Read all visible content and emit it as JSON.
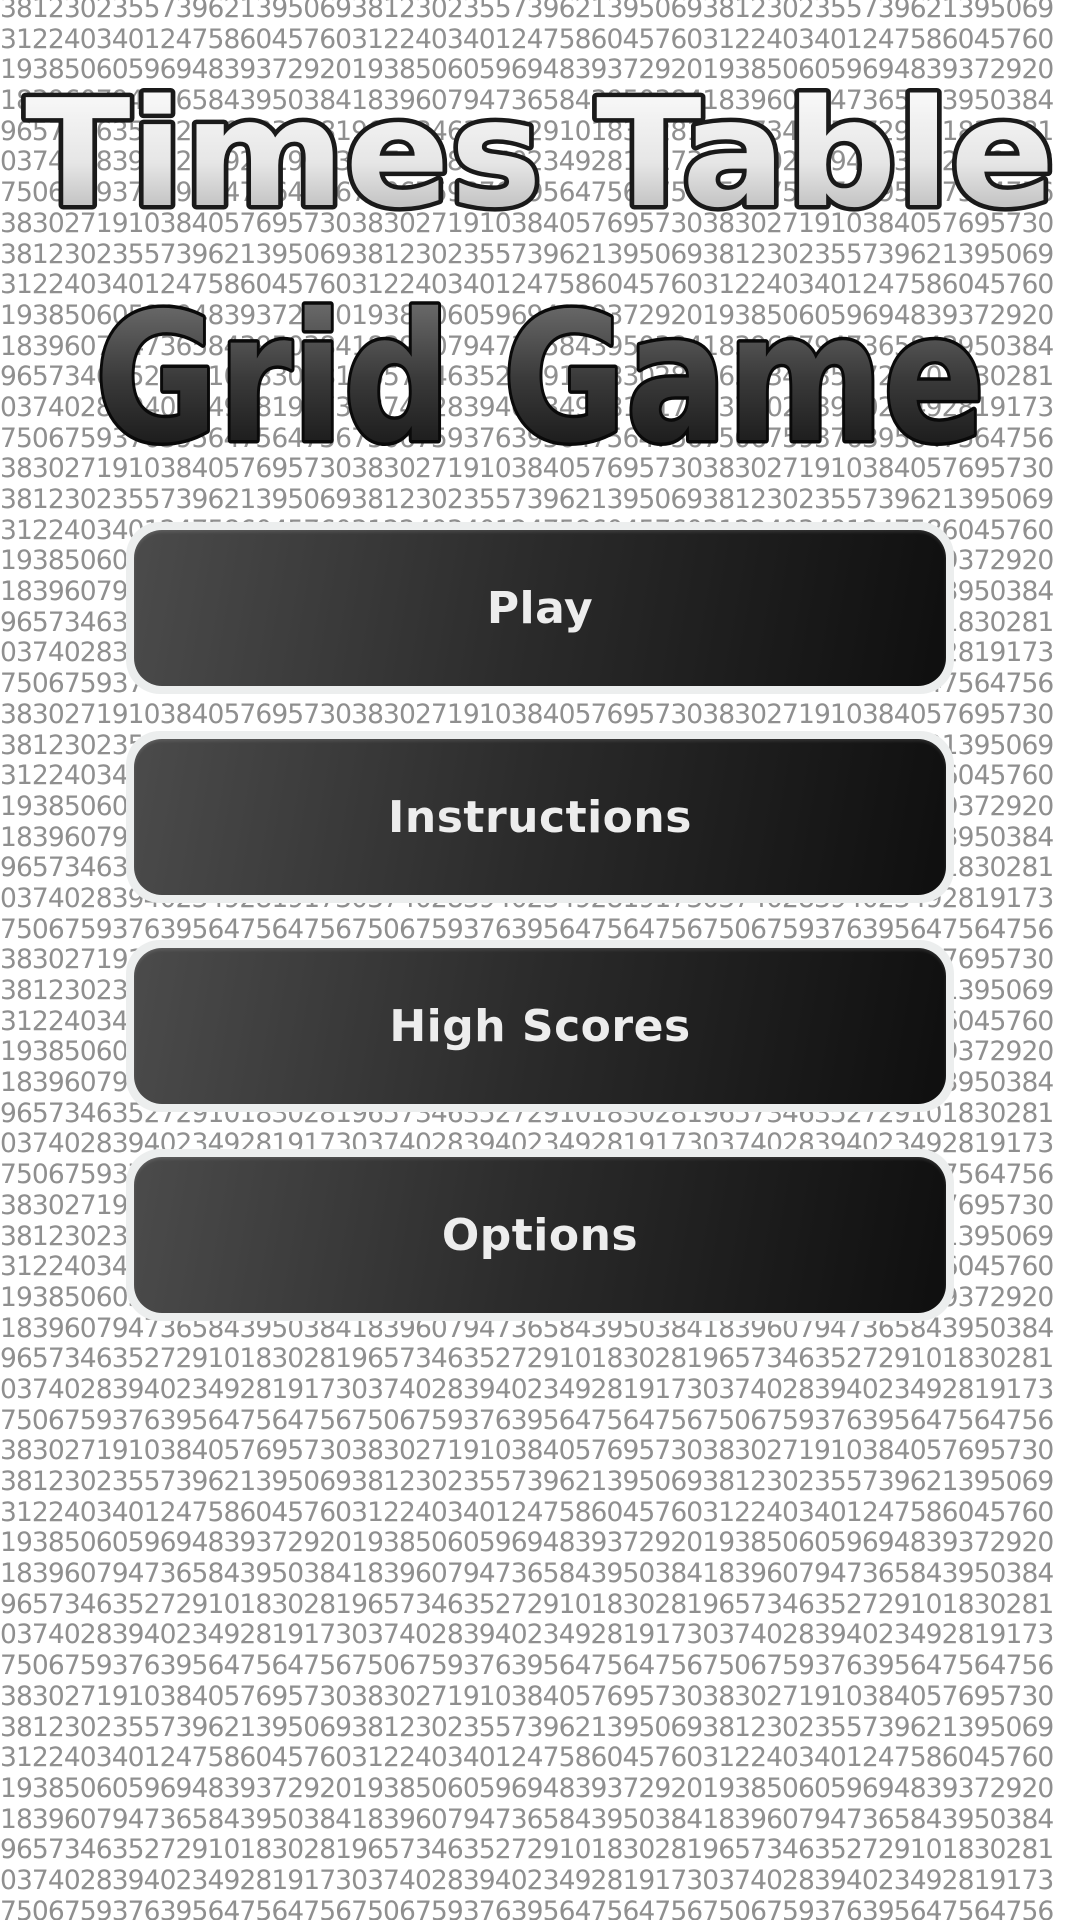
{
  "app": {
    "title_line1": "Times Table",
    "title_line2": "Grid Game"
  },
  "menu": {
    "play_label": "Play",
    "instructions_label": "Instructions",
    "high_scores_label": "High Scores",
    "options_label": "Options"
  },
  "background_digits": [
    "3812302355739621395069",
    "3122403401247586045760",
    "1938506059694839372920",
    "1839607947365843950384",
    "9657346352729101830281",
    "0374028394023492819173",
    "7506759376395647564756",
    "3830271910384057695730"
  ],
  "colors": {
    "background": "#ffffff",
    "digits": "#8f8f8f",
    "button_border": "#eceeee",
    "button_gradient_start": "#4b4b4b",
    "button_gradient_end": "#0f0f0f",
    "button_text": "#ededed"
  }
}
